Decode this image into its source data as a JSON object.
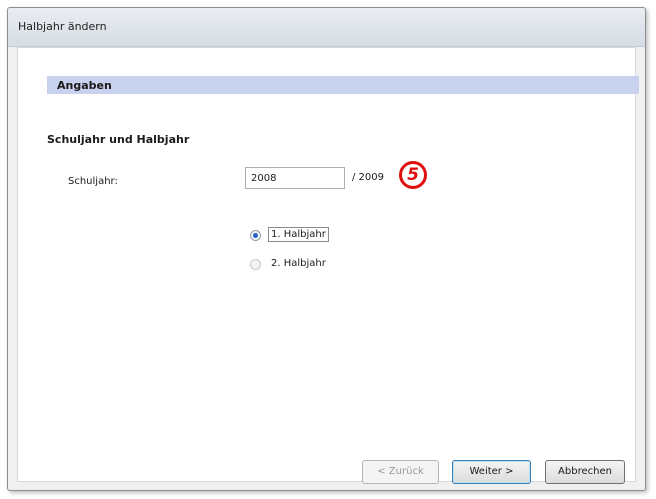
{
  "window": {
    "title": "Halbjahr ändern"
  },
  "section": {
    "header": "Angaben",
    "group_title": "Schuljahr und Halbjahr"
  },
  "school_year": {
    "label": "Schuljahr:",
    "value": "2008",
    "suffix": "/ 2009"
  },
  "annotation": {
    "number": "5"
  },
  "half_year": {
    "options": [
      {
        "label": "1. Halbjahr",
        "selected": true,
        "enabled": true
      },
      {
        "label": "2. Halbjahr",
        "selected": false,
        "enabled": false
      }
    ]
  },
  "buttons": {
    "back": "< Zurück",
    "next": "Weiter >",
    "cancel": "Abbrechen"
  },
  "colors": {
    "section_header_bg": "#c8d2ee",
    "callout": "#e01010"
  }
}
